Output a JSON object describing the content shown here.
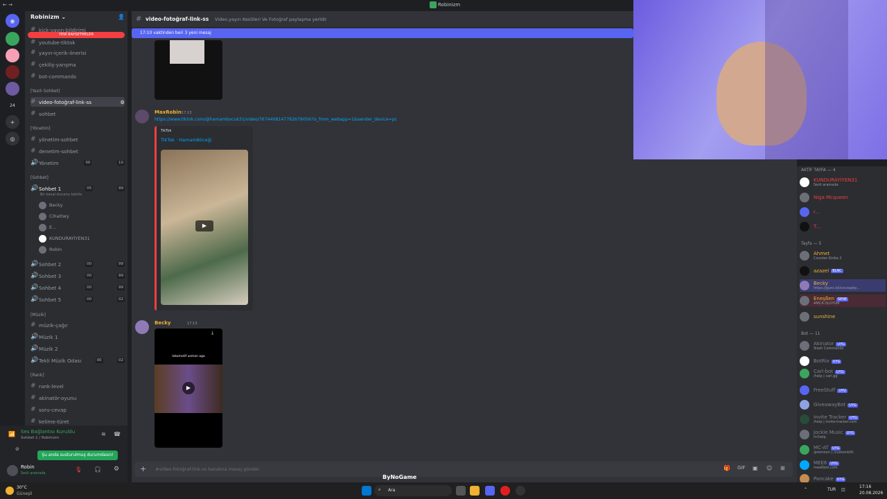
{
  "window": {
    "title": "Robinizm"
  },
  "server": {
    "name": "Robinizm"
  },
  "channels": {
    "top_cut": "kick-yayın-bildirimi",
    "new_events": "YENİ BAHSETMELER",
    "items": [
      {
        "icon": "#",
        "name": "youtube-tiktok"
      },
      {
        "icon": "#",
        "name": "yayın-içerik-önerisi"
      },
      {
        "icon": "#",
        "name": "çekiliş-yarışma"
      },
      {
        "icon": "#",
        "name": "bot-commands"
      }
    ],
    "cat_yazili": "[Yazılı Sohbet]",
    "active": "video-fotoğraf-link-ss",
    "sohbet": "sohbet",
    "cat_yonetim": "[Yönetim]",
    "yonetim_items": [
      "yönetim-sohbet",
      "denetim-sohbet"
    ],
    "yonetim_voice": {
      "name": "Yönetim",
      "a": "00",
      "b": "10"
    },
    "cat_sohbet": "[Sohbet]",
    "sohbet1": {
      "name": "Sohbet 1",
      "a": "05",
      "b": "99",
      "status": "Bir kanal durumu belirle"
    },
    "voice_members": [
      "Becky",
      "Cihattwy",
      "E...",
      "KUNDURAYİYEN31",
      "Robin"
    ],
    "voice_channels": [
      {
        "name": "Sohbet 2",
        "a": "00",
        "b": "99"
      },
      {
        "name": "Sohbet 3",
        "a": "00",
        "b": "99"
      },
      {
        "name": "Sohbet 4",
        "a": "00",
        "b": "99"
      },
      {
        "name": "Sohbet 5",
        "a": "00",
        "b": "02"
      }
    ],
    "cat_muzik": "[Müzik]",
    "muzik_items": [
      "müzik-çağır"
    ],
    "muzik_voice": [
      "Müzik 1",
      "Müzik 2"
    ],
    "tekli": {
      "name": "Tekli Müzik Odası",
      "a": "00",
      "b": "02"
    },
    "cat_rank": "[Rank]",
    "rank_items": [
      "rank-level",
      "akinatör-oyunu",
      "soru-cevap",
      "kelime-türet"
    ]
  },
  "voice_panel": {
    "status": "Ses Bağlantısı Kuruldu",
    "channel": "Sohbet 1 / Robinizm",
    "tooltip": "Şu anda susturulmuş durumdasın!"
  },
  "user": {
    "name": "Robin",
    "status": "Sesli aramada"
  },
  "header": {
    "channel": "video-fotoğraf-link-ss",
    "topic": "Video,yayın Kesitleri Ve Fotoğraf paylaşma yerldir"
  },
  "banner": {
    "text": "17:10 vaktinden beri 3 yeni mesaj"
  },
  "messages": [
    {
      "author": "MaxRobin",
      "time": "17:13",
      "link": "https://www.tiktok.com/@hamambocuk31/video/7674408147762679056?is_from_webapp=1&sender_device=pc",
      "embed_provider": "TikTok",
      "embed_title": "TikTok · HamamBöceği"
    },
    {
      "author": "Becky",
      "time": "17:13",
      "video_caption": "lokomotif usman aga"
    }
  ],
  "composer": {
    "placeholder": "#video-fotoğraf-link-ss kanalına mesaj gönder"
  },
  "members": {
    "aktif_header": "AKTİF TAYFA — 4",
    "aktif": [
      {
        "name": "KUNDURAYİYEN31",
        "sub": "Sesli aramada",
        "color": "#f23f42"
      },
      {
        "name": "Niga Mcqueen",
        "sub": "",
        "color": "#f23f42"
      },
      {
        "name": "r...",
        "sub": "",
        "color": "#f23f42"
      },
      {
        "name": "T...",
        "sub": "",
        "color": "#f23f42"
      }
    ],
    "tayfa_header": "Tayfa — 5",
    "tayfa": [
      {
        "name": "Ahmet",
        "sub": "Counter-Strike 2",
        "color": "#f0b232"
      },
      {
        "name": "azazel",
        "sub": "",
        "tag": "BLNC",
        "color": "#f0b232"
      },
      {
        "name": "Becky",
        "sub": "https://guns.lol/cocoaptp...",
        "color": "#f0b232"
      },
      {
        "name": "Eneşßen",
        "sub": "AMCA OLUYOM",
        "tag": "SENE",
        "color": "#f0b232"
      },
      {
        "name": "sunshine",
        "sub": "",
        "color": "#f0b232"
      }
    ],
    "bot_header": "Bot — 11",
    "bots": [
      {
        "name": "Akinator",
        "sub": "Slash Commands"
      },
      {
        "name": "BotRix",
        "sub": ""
      },
      {
        "name": "Carl-bot",
        "sub": "/help | carl.gg"
      },
      {
        "name": "FreeStuff",
        "sub": ""
      },
      {
        "name": "GiveawayBot",
        "sub": ""
      },
      {
        "name": "Invite Tracker",
        "sub": "/help | invite-tracker.com"
      },
      {
        "name": "Jockie Music",
        "sub": "m!help"
      },
      {
        "name": "MC-AT",
        "sub": "/premium | /customb0t"
      },
      {
        "name": "MEE6",
        "sub": "mee6bot.com"
      },
      {
        "name": "Pancake",
        "sub": ""
      }
    ],
    "bot_tag": "UYG"
  },
  "watermark": "ByNoGame",
  "taskbar": {
    "weather_temp": "30°C",
    "weather_text": "Güneşli",
    "search": "Ara",
    "lang": "TUR",
    "time": "17:16",
    "date": "20.08.2026"
  }
}
